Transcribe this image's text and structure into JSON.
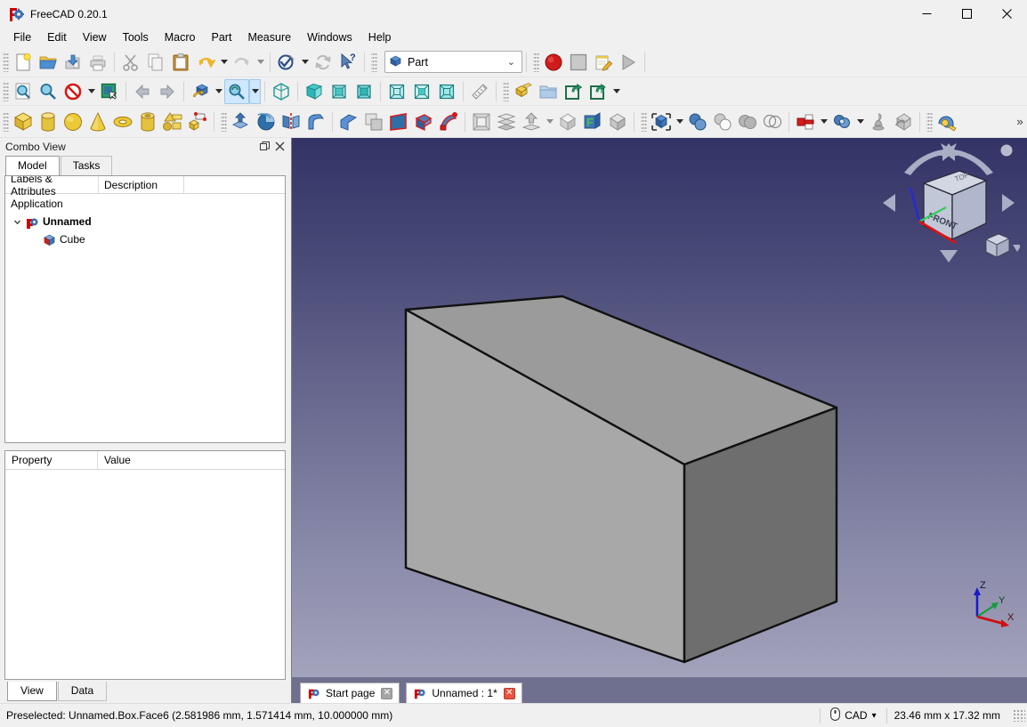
{
  "window": {
    "title": "FreeCAD 0.20.1",
    "app_icon": "freecad-logo-icon",
    "minimize_label": "—",
    "maximize_label": "☐",
    "close_label": "✕"
  },
  "menubar": {
    "items": [
      {
        "label": "File"
      },
      {
        "label": "Edit"
      },
      {
        "label": "View"
      },
      {
        "label": "Tools"
      },
      {
        "label": "Macro"
      },
      {
        "label": "Part"
      },
      {
        "label": "Measure"
      },
      {
        "label": "Windows"
      },
      {
        "label": "Help"
      }
    ]
  },
  "toolbars": {
    "file": [
      {
        "name": "new-document-button",
        "icon": "new-file-icon"
      },
      {
        "name": "open-document-button",
        "icon": "open-folder-icon"
      },
      {
        "name": "save-document-button",
        "icon": "save-icon"
      },
      {
        "name": "print-button",
        "icon": "print-icon"
      }
    ],
    "edit": [
      {
        "name": "cut-button",
        "icon": "scissors-icon"
      },
      {
        "name": "copy-button",
        "icon": "copy-icon"
      },
      {
        "name": "paste-button",
        "icon": "clipboard-paste-icon"
      },
      {
        "name": "undo-button",
        "icon": "undo-arrow-icon"
      },
      {
        "name": "redo-button",
        "icon": "redo-arrow-icon"
      },
      {
        "name": "refresh-button",
        "icon": "refresh-icon"
      },
      {
        "name": "whats-this-button",
        "icon": "cursor-question-icon"
      }
    ],
    "workbench": {
      "selected": "Part",
      "icon": "part-cube-icon",
      "arrow": "⌄"
    },
    "macro": [
      {
        "name": "macro-record-button",
        "icon": "record-circle-icon"
      },
      {
        "name": "macro-stop-button",
        "icon": "stop-square-icon"
      },
      {
        "name": "macro-edit-button",
        "icon": "notepad-pencil-icon"
      },
      {
        "name": "macro-execute-button",
        "icon": "play-triangle-icon"
      }
    ],
    "view_row": [
      {
        "name": "fit-all-button",
        "icon": "fit-all-icon"
      },
      {
        "name": "fit-selection-button",
        "icon": "magnifier-icon"
      },
      {
        "name": "draw-style-button",
        "icon": "no-entry-icon"
      },
      {
        "name": "box-selection-button",
        "icon": "box-select-icon"
      },
      {
        "name": "view-back-button",
        "icon": "left-arrow-icon"
      },
      {
        "name": "view-forward-button",
        "icon": "right-arrow-icon"
      },
      {
        "name": "view-rotate-button",
        "icon": "rotate-cube-icon"
      },
      {
        "name": "zoom-tool-button",
        "icon": "zoom-cube-icon"
      },
      {
        "name": "axonometric-view-button",
        "icon": "isometric-cube-icon"
      },
      {
        "name": "front-view-button",
        "icon": "front-view-icon"
      },
      {
        "name": "top-view-button",
        "icon": "top-view-icon"
      },
      {
        "name": "right-view-button",
        "icon": "right-view-icon"
      },
      {
        "name": "rear-view-button",
        "icon": "rear-view-icon"
      },
      {
        "name": "bottom-view-button",
        "icon": "bottom-view-icon"
      },
      {
        "name": "left-view-button",
        "icon": "left-view-icon"
      },
      {
        "name": "measure-button",
        "icon": "ruler-icon"
      },
      {
        "name": "create-part-button",
        "icon": "yellow-part-icon"
      },
      {
        "name": "create-group-button",
        "icon": "folder-icon"
      },
      {
        "name": "link-object-button",
        "icon": "link-arrow-icon"
      },
      {
        "name": "link-group-button",
        "icon": "link-group-icon"
      }
    ],
    "part_primitives": [
      {
        "name": "box-primitive-button",
        "icon": "yellow-cube-icon"
      },
      {
        "name": "cylinder-primitive-button",
        "icon": "yellow-cylinder-icon"
      },
      {
        "name": "sphere-primitive-button",
        "icon": "yellow-sphere-icon"
      },
      {
        "name": "cone-primitive-button",
        "icon": "yellow-cone-icon"
      },
      {
        "name": "torus-primitive-button",
        "icon": "yellow-torus-icon"
      },
      {
        "name": "tube-primitive-button",
        "icon": "yellow-tube-icon"
      },
      {
        "name": "shape-builder-button",
        "icon": "shape-builder-icon"
      },
      {
        "name": "primitives-dialog-button",
        "icon": "primitives-icon"
      }
    ],
    "part_tools": [
      {
        "name": "extrude-button",
        "icon": "extrude-icon"
      },
      {
        "name": "revolve-button",
        "icon": "revolve-icon"
      },
      {
        "name": "mirror-button",
        "icon": "mirror-icon"
      },
      {
        "name": "fillet-button",
        "icon": "fillet-icon"
      },
      {
        "name": "chamfer-button",
        "icon": "chamfer-icon"
      },
      {
        "name": "make-face-button",
        "icon": "make-face-icon"
      },
      {
        "name": "ruled-surface-button",
        "icon": "ruled-surface-icon"
      },
      {
        "name": "loft-button",
        "icon": "loft-icon"
      },
      {
        "name": "sweep-button",
        "icon": "sweep-icon"
      },
      {
        "name": "section-button",
        "icon": "section-icon"
      },
      {
        "name": "cross-sections-button",
        "icon": "cross-sections-icon"
      },
      {
        "name": "offset-3d-button",
        "icon": "offset-3d-icon"
      },
      {
        "name": "thickness-button",
        "icon": "thickness-icon"
      },
      {
        "name": "projection-shape-button",
        "icon": "projection-icon"
      },
      {
        "name": "color-per-face-button",
        "icon": "color-face-icon"
      }
    ],
    "boolean": [
      {
        "name": "compound-tools-button",
        "icon": "compound-icon"
      },
      {
        "name": "boolean-button",
        "icon": "boolean-icon"
      },
      {
        "name": "cut-shapes-button",
        "icon": "cut-shapes-icon"
      },
      {
        "name": "union-button",
        "icon": "union-icon"
      },
      {
        "name": "intersection-button",
        "icon": "intersection-icon"
      },
      {
        "name": "join-objects-button",
        "icon": "join-icon"
      },
      {
        "name": "split-objects-button",
        "icon": "split-icon"
      },
      {
        "name": "check-geometry-button",
        "icon": "check-geometry-icon"
      },
      {
        "name": "defeaturing-button",
        "icon": "defeaturing-icon"
      },
      {
        "name": "measure-toolbar-button",
        "icon": "tape-measure-icon"
      }
    ],
    "overflow_label": "»"
  },
  "combo_view": {
    "title": "Combo View",
    "float_label": "❐",
    "close_label": "✕",
    "tabs": [
      {
        "label": "Model",
        "selected": true
      },
      {
        "label": "Tasks",
        "selected": false
      }
    ],
    "tree": {
      "columns": [
        "Labels & Attributes",
        "Description",
        ""
      ],
      "rows": [
        {
          "label": "Application",
          "level": 0,
          "icon": "",
          "expander": "",
          "bold": false
        },
        {
          "label": "Unnamed",
          "level": 1,
          "icon": "document-icon",
          "expander": "⌄",
          "bold": true
        },
        {
          "label": "Cube",
          "level": 2,
          "icon": "box-object-icon",
          "expander": "",
          "bold": false
        }
      ]
    },
    "property_editor": {
      "columns": [
        "Property",
        "Value"
      ],
      "rows": []
    },
    "bottom_tabs": [
      {
        "label": "View",
        "selected": true
      },
      {
        "label": "Data",
        "selected": false
      }
    ]
  },
  "view3d": {
    "navigation_cube": {
      "top_face_label": "TOP",
      "front_face_label": "FRONT"
    },
    "axis_labels": {
      "x": "X",
      "y": "Y",
      "z": "Z"
    },
    "background_top": "#333366",
    "background_bottom": "#a3a3bc",
    "cube_top_color": "#9b9b9b",
    "cube_left_color": "#a8a8a8",
    "cube_right_color": "#6e6e6e",
    "edge_color": "#101010"
  },
  "document_tabs": [
    {
      "label": "Start page",
      "icon": "freecad-logo-icon",
      "close_style": "gray",
      "close_label": "✕",
      "selected": false
    },
    {
      "label": "Unnamed : 1*",
      "icon": "freecad-logo-icon",
      "close_style": "red",
      "close_label": "✕",
      "selected": true
    }
  ],
  "statusbar": {
    "message": "Preselected: Unnamed.Box.Face6 (2.581986 mm, 1.571414 mm, 10.000000 mm)",
    "navigation_mode": "CAD",
    "navigation_icon": "mouse-icon",
    "navigation_arrow": "▾",
    "dimensions": "23.46 mm x 17.32 mm"
  }
}
